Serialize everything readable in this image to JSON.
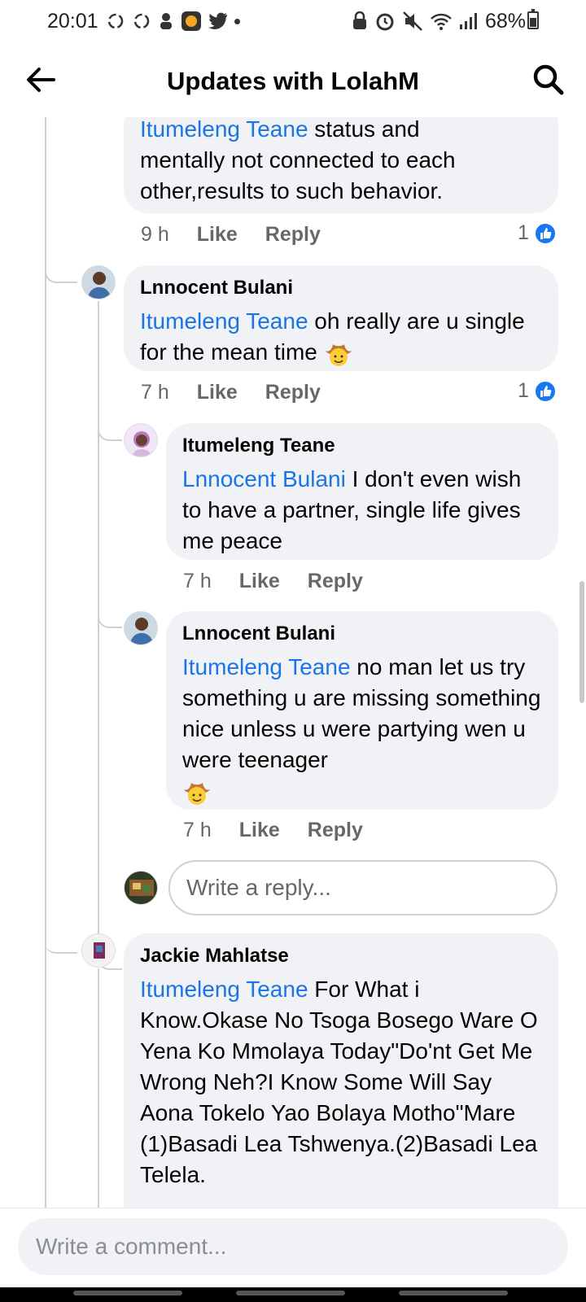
{
  "status_bar": {
    "time": "20:01",
    "battery": "68%"
  },
  "header": {
    "title": "Updates with LolahM"
  },
  "comments": [
    {
      "mention": "Itumeleng Teane",
      "text_line1_rest": " status and",
      "text_rest": "mentally not connected to each other,results to such behavior.",
      "time": "9 h",
      "like": "Like",
      "reply": "Reply",
      "reactions": "1"
    },
    {
      "author": "Lnnocent Bulani",
      "mention": "Itumeleng Teane",
      "text": " oh really  are u single for the mean time",
      "emoji": "cowboy-emoji",
      "time": "7 h",
      "like": "Like",
      "reply": "Reply",
      "reactions": "1"
    },
    {
      "author": "Itumeleng Teane",
      "mention": "Lnnocent Bulani",
      "text": " I don't even wish to have a partner, single life gives me peace",
      "time": "7 h",
      "like": "Like",
      "reply": "Reply"
    },
    {
      "author": "Lnnocent Bulani",
      "mention": "Itumeleng Teane",
      "text": " no man let us try something  u are missing something nice unless  u were partying  wen u were teenager",
      "emoji": "cowboy-emoji",
      "time": "7 h",
      "like": "Like",
      "reply": "Reply"
    },
    {
      "author": "Jackie Mahlatse",
      "mention": "Itumeleng Teane",
      "text": " For What i Know.Okase No Tsoga Bosego Ware O Yena Ko Mmolaya Today\"Do'nt Get Me Wrong Neh?I Know Some Will Say Aona Tokelo Yao Bolaya Motho\"Mare (1)Basadi Lea Tshwenya.(2)Basadi Lea Telela."
    }
  ],
  "reply_box": {
    "placeholder": "Write a reply..."
  },
  "comment_box": {
    "placeholder": "Write a comment..."
  },
  "colors": {
    "mention": "#1b74e4",
    "bubble": "#f0f2f5",
    "meta": "#65676b",
    "like_badge": "#1877f2"
  }
}
